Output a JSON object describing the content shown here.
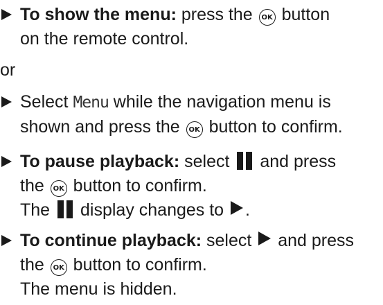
{
  "step1": {
    "bold": "To show the menu:",
    "text_a": " press the",
    "ok_label": "OK",
    "text_b": " button",
    "line2": "on the remote control."
  },
  "or_word": "or",
  "step2": {
    "text_a": "Select ",
    "menu_word": "Menu",
    "text_b": " while the navigation menu is",
    "line2_a": "shown and press the",
    "ok_label": "OK",
    "line2_b": " button to confirm."
  },
  "step3": {
    "bold": "To pause playback:",
    "text_a": " select",
    "text_b": " and press",
    "line2_a": "the",
    "ok_label": "OK",
    "line2_b": " button to confirm.",
    "line3_a": "The",
    "line3_b": " display changes to",
    "line3_c": "."
  },
  "step4": {
    "bold": "To continue playback:",
    "text_a": " select",
    "text_b": " and press",
    "line2_a": "the",
    "ok_label": "OK",
    "line2_b": " button to confirm.",
    "line3": "The menu is hidden."
  },
  "icons": {
    "step_arrow": "right-triangle-bullet",
    "ok_button": "ok-button-circle",
    "pause": "pause-bars",
    "play": "play-triangle"
  }
}
